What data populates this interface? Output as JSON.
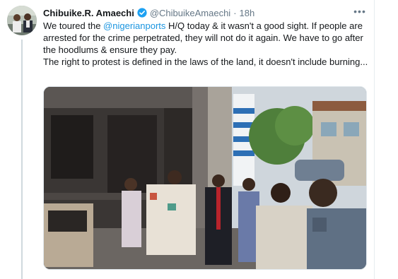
{
  "tweet": {
    "display_name": "Chibuike.R. Amaechi",
    "handle": "@ChibuikeAmaechi",
    "separator": "·",
    "time": "18h",
    "more_glyph": "•••",
    "text_line1_prefix": "We toured the ",
    "mention": "@nigerianports",
    "text_line1_suffix": " H/Q today & it wasn't a good sight. If people are arrested for the crime perpetrated, they will not do it again. We have to go after the hoodlums & ensure they pay.",
    "text_line2": "The right to protest is defined in the laws of the land, it doesn't include burning..."
  },
  "icons": {
    "verified": "verified-badge-icon",
    "more": "more-options-icon"
  },
  "colors": {
    "mention": "#1b95e0",
    "verified": "#1da1f2",
    "secondary_text": "#657786",
    "primary_text": "#14171a"
  }
}
